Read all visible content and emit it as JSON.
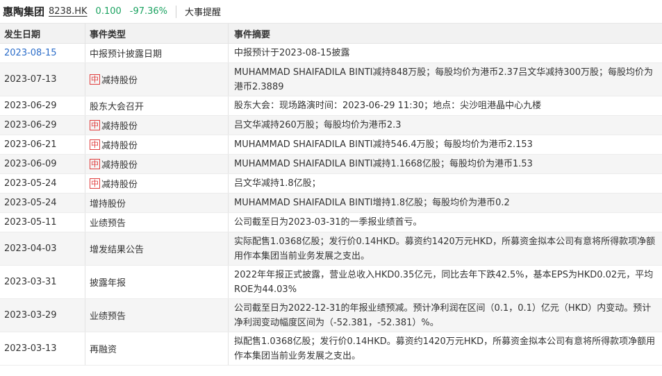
{
  "header": {
    "name": "惠陶集团",
    "code": "8238.HK",
    "price": "0.100",
    "change": "-97.36%",
    "title": "大事提醒"
  },
  "columns": [
    "发生日期",
    "事件类型",
    "事件摘要"
  ],
  "rows": [
    {
      "date": "2023-08-15",
      "type": "中报预计披露日期",
      "summary": "中报预计于2023-08-15披露",
      "tag": false,
      "link": true,
      "h": 28
    },
    {
      "date": "2023-07-13",
      "type": "减持股份",
      "summary": "MUHAMMAD SHAIFADILA BINTI减持848万股；每股均价为港币2.37吕文华减持300万股；每股均价为港币2.3889",
      "tag": true,
      "link": false,
      "h": 48
    },
    {
      "date": "2023-06-29",
      "type": "股东大会召开",
      "summary": "股东大会：现场路演时间：2023-06-29 11:30；地点：尖沙咀港晶中心九楼",
      "tag": false,
      "link": false,
      "h": 28
    },
    {
      "date": "2023-06-29",
      "type": "减持股份",
      "summary": "吕文华减持260万股；每股均价为港币2.3",
      "tag": true,
      "link": false,
      "h": 28
    },
    {
      "date": "2023-06-21",
      "type": "减持股份",
      "summary": "MUHAMMAD SHAIFADILA BINTI减持546.4万股；每股均价为港币2.153",
      "tag": true,
      "link": false,
      "h": 28
    },
    {
      "date": "2023-06-09",
      "type": "减持股份",
      "summary": "MUHAMMAD SHAIFADILA BINTI减持1.1668亿股；每股均价为港币1.53",
      "tag": true,
      "link": false,
      "h": 28
    },
    {
      "date": "2023-05-24",
      "type": "减持股份",
      "summary": "吕文华减持1.8亿股；",
      "tag": true,
      "link": false,
      "h": 28
    },
    {
      "date": "2023-05-24",
      "type": "增持股份",
      "summary": "MUHAMMAD SHAIFADILA BINTI增持1.8亿股；每股均价为港币0.2",
      "tag": false,
      "link": false,
      "h": 28
    },
    {
      "date": "2023-05-11",
      "type": "业绩预告",
      "summary": "公司截至日为2023-03-31的一季报业绩首亏。",
      "tag": false,
      "link": false,
      "h": 28
    },
    {
      "date": "2023-04-03",
      "type": "增发结果公告",
      "summary": "实际配售1.0368亿股；发行价0.14HKD。募资约1420万元HKD，所募资金拟本公司有意将所得款项净额用作本集团当前业务发展之支出。",
      "tag": false,
      "link": false,
      "h": 48
    },
    {
      "date": "2023-03-31",
      "type": "披露年报",
      "summary": "2022年年报正式披露，营业总收入HKD0.35亿元，同比去年下跌42.5%，基本EPS为HKD0.02元，平均ROE为44.03%",
      "tag": false,
      "link": false,
      "h": 48
    },
    {
      "date": "2023-03-29",
      "type": "业绩预告",
      "summary": "公司截至日为2022-12-31的年报业绩预减。预计净利润在区间（0.1，0.1）亿元（HKD）内变动。预计净利润变动幅度区间为（-52.381，-52.381）%。",
      "tag": false,
      "link": false,
      "h": 48
    },
    {
      "date": "2023-03-13",
      "type": "再融资",
      "summary": "拟配售1.0368亿股；发行价0.14HKD。募资约1420万元HKD，所募资金拟本公司有意将所得款项净额用作本集团当前业务发展之支出。",
      "tag": false,
      "link": false,
      "h": 48
    }
  ]
}
